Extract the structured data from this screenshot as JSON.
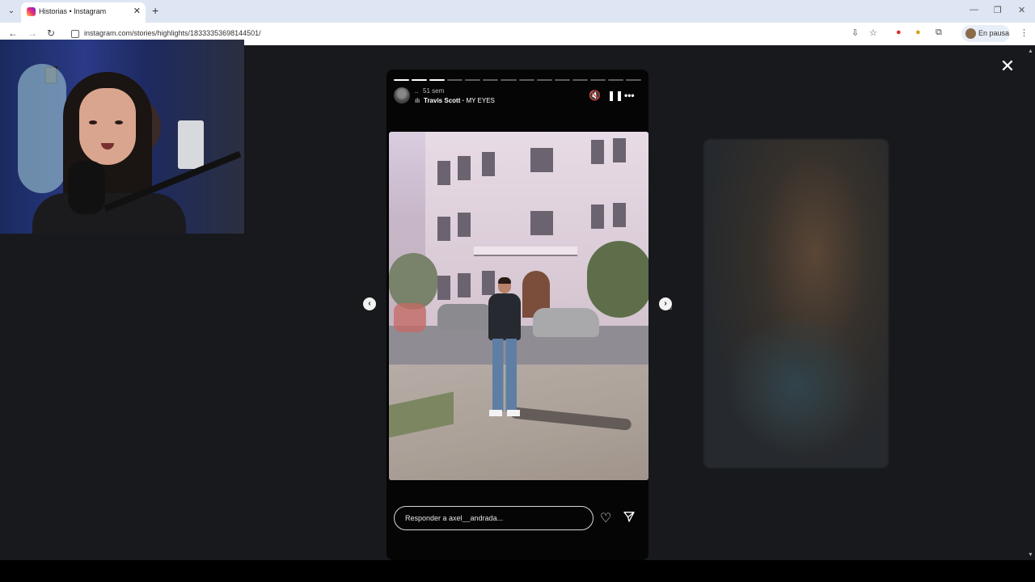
{
  "browser": {
    "tab_title": "Historias • Instagram",
    "tab_close": "✕",
    "new_tab": "+",
    "url": "instagram.com/stories/highlights/18333353698144501/",
    "profile_label": "En pausa",
    "window_controls": [
      "—",
      "❐",
      "✕"
    ]
  },
  "story": {
    "username": "..",
    "time_ago": "51 sem",
    "music_artist": "Travis Scott",
    "music_title": "MY EYES",
    "music_separator": " · ",
    "segments_total": 14,
    "segments_done": 3,
    "reply_placeholder": "Responder a axel__andrada...",
    "icons": {
      "mute": "speaker-muted-icon",
      "pause": "pause-icon",
      "more": "more-icon",
      "heart": "heart-icon",
      "send": "send-icon"
    }
  },
  "colors": {
    "page_bg": "#17191c",
    "story_bg": "#050505",
    "tab_bar": "#dfe6f3"
  }
}
